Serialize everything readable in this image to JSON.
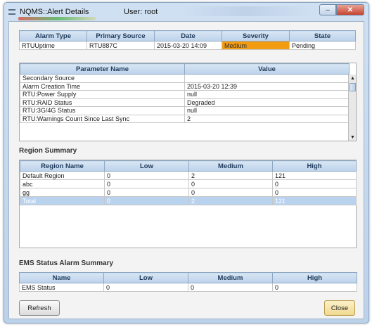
{
  "window": {
    "title": "NQMS::Alert Details",
    "user_text": "User: root",
    "min_glyph": "–",
    "close_glyph": "✕"
  },
  "alarm": {
    "headers": [
      "Alarm Type",
      "Primary Source",
      "Date",
      "Severity",
      "State"
    ],
    "row": [
      "RTUUptime",
      "RTU887C",
      "2015-03-20 14:09",
      "Medium",
      "Pending"
    ],
    "severity_color": "#f39c12"
  },
  "params": {
    "headers": [
      "Parameter Name",
      "Value"
    ],
    "rows": [
      [
        "Secondary Source",
        ""
      ],
      [
        "Alarm Creation Time",
        "2015-03-20 12:39"
      ],
      [
        "RTU:Power Supply",
        "null"
      ],
      [
        "RTU:RAID Status",
        "Degraded"
      ],
      [
        "RTU:3G/4G Status",
        "null"
      ],
      [
        "RTU:Warnings Count Since Last Sync",
        "2"
      ]
    ]
  },
  "region_summary": {
    "label": "Region Summary",
    "headers": [
      "Region Name",
      "Low",
      "Medium",
      "High"
    ],
    "rows": [
      [
        "Default Region",
        "0",
        "2",
        "121"
      ],
      [
        "abc",
        "0",
        "0",
        "0"
      ],
      [
        "gg",
        "0",
        "0",
        "0"
      ]
    ],
    "total": [
      "Total",
      "0",
      "2",
      "121"
    ],
    "total_row_color": "#b9d3ef"
  },
  "ems_summary": {
    "label": "EMS Status Alarm Summary",
    "headers": [
      "Name",
      "Low",
      "Medium",
      "High"
    ],
    "row": [
      "EMS Status",
      "0",
      "0",
      "0"
    ]
  },
  "buttons": {
    "refresh": "Refresh",
    "close": "Close"
  },
  "scroll": {
    "up": "▲",
    "down": "▼"
  }
}
